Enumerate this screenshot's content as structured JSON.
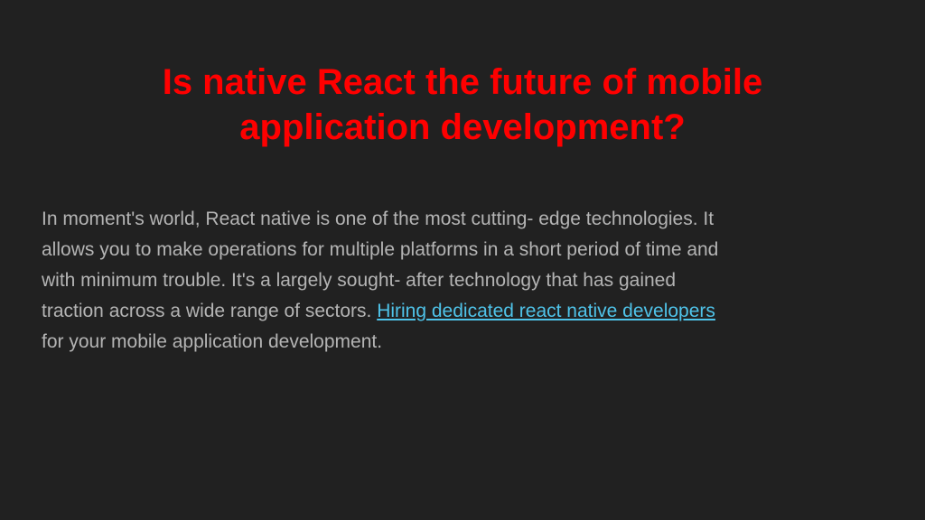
{
  "slide": {
    "title_line1": "Is native React the future of mobile",
    "title_line2": "application development?",
    "body_line1": "In moment's world, React native is one of the most cutting- edge technologies. It",
    "body_line2": "allows you to make operations for multiple platforms in a short period of time and",
    "body_line3": "with minimum trouble. It's a largely sought- after technology that has gained",
    "body_line4_prefix": "traction across a wide range of sectors.",
    "link_text": "Hiring dedicated react native developers",
    "body_line5": "for your mobile application development."
  },
  "colors": {
    "background": "#212121",
    "title": "#ff0000",
    "body_text": "#b4b4b4",
    "link": "#4fc3e9"
  }
}
